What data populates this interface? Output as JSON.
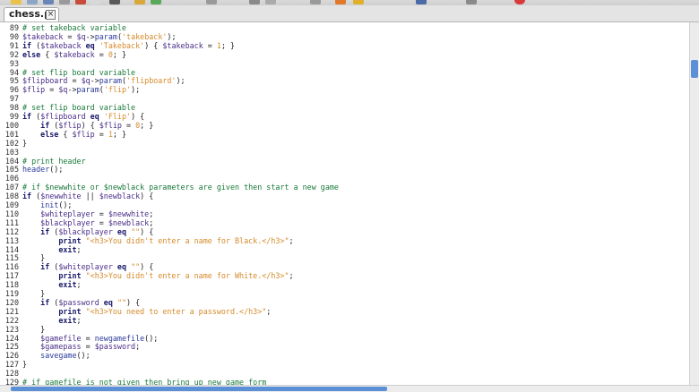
{
  "tab": {
    "title": "chess.pl",
    "close_glyph": "×"
  },
  "toolbar": {
    "icons": [
      "new-file-icon",
      "open-icon",
      "save-icon",
      "print-icon",
      "undo-icon",
      "redo-icon",
      "cut-icon",
      "copy-icon",
      "paste-icon",
      "find-icon",
      "replace-icon",
      "goto-icon",
      "bookmark-icon",
      "run-icon",
      "stop-icon",
      "bracket-icon",
      "settings-icon",
      "close-icon"
    ]
  },
  "lines": [
    {
      "n": "89",
      "html": "<span class='cm'># set takeback variable</span>"
    },
    {
      "n": "90",
      "html": "<span class='var'>$takeback</span> = <span class='var'>$q</span>-><span class='fn'>param</span>(<span class='str'>'takeback'</span>);"
    },
    {
      "n": "91",
      "html": "<span class='kw'>if</span> (<span class='var'>$takeback</span> <span class='kw'>eq</span> <span class='str'>'Takeback'</span>) { <span class='var'>$takeback</span> = <span class='str'>1</span>; }"
    },
    {
      "n": "92",
      "html": "<span class='kw'>else</span> { <span class='var'>$takeback</span> = <span class='str'>0</span>; }"
    },
    {
      "n": "93",
      "html": ""
    },
    {
      "n": "94",
      "html": "<span class='cm'># set flip board variable</span>"
    },
    {
      "n": "95",
      "html": "<span class='var'>$flipboard</span> = <span class='var'>$q</span>-><span class='fn'>param</span>(<span class='str'>'flipboard'</span>);"
    },
    {
      "n": "96",
      "html": "<span class='var'>$flip</span> = <span class='var'>$q</span>-><span class='fn'>param</span>(<span class='str'>'flip'</span>);"
    },
    {
      "n": "97",
      "html": ""
    },
    {
      "n": "98",
      "html": "<span class='cm'># set flip board variable</span>"
    },
    {
      "n": "99",
      "html": "<span class='kw'>if</span> (<span class='var'>$flipboard</span> <span class='kw'>eq</span> <span class='str'>'Flip'</span>) {"
    },
    {
      "n": "100",
      "html": "    <span class='kw'>if</span> (<span class='var'>$flip</span>) { <span class='var'>$flip</span> = <span class='str'>0</span>; }"
    },
    {
      "n": "101",
      "html": "    <span class='kw'>else</span> { <span class='var'>$flip</span> = <span class='str'>1</span>; }"
    },
    {
      "n": "102",
      "html": "}"
    },
    {
      "n": "103",
      "html": ""
    },
    {
      "n": "104",
      "html": "<span class='cm'># print header</span>"
    },
    {
      "n": "105",
      "html": "<span class='fn'>header</span>();"
    },
    {
      "n": "106",
      "html": ""
    },
    {
      "n": "107",
      "html": "<span class='cm'># if $newwhite or $newblack parameters are given then start a new game</span>"
    },
    {
      "n": "108",
      "html": "<span class='kw'>if</span> (<span class='var'>$newwhite</span> || <span class='var'>$newblack</span>) {"
    },
    {
      "n": "109",
      "html": "    <span class='fn'>init</span>();"
    },
    {
      "n": "110",
      "html": "    <span class='var'>$whiteplayer</span> = <span class='var'>$newwhite</span>;"
    },
    {
      "n": "111",
      "html": "    <span class='var'>$blackplayer</span> = <span class='var'>$newblack</span>;"
    },
    {
      "n": "112",
      "html": "    <span class='kw'>if</span> (<span class='var'>$blackplayer</span> <span class='kw'>eq</span> <span class='str'>\"\"</span>) {"
    },
    {
      "n": "113",
      "html": "        <span class='kw'>print</span> <span class='str'>\"&lt;h3&gt;You didn't enter a name for Black.&lt;/h3&gt;\"</span>;"
    },
    {
      "n": "114",
      "html": "        <span class='kw'>exit</span>;"
    },
    {
      "n": "115",
      "html": "    }"
    },
    {
      "n": "116",
      "html": "    <span class='kw'>if</span> (<span class='var'>$whiteplayer</span> <span class='kw'>eq</span> <span class='str'>\"\"</span>) {"
    },
    {
      "n": "117",
      "html": "        <span class='kw'>print</span> <span class='str'>\"&lt;h3&gt;You didn't enter a name for White.&lt;/h3&gt;\"</span>;"
    },
    {
      "n": "118",
      "html": "        <span class='kw'>exit</span>;"
    },
    {
      "n": "119",
      "html": "    }"
    },
    {
      "n": "120",
      "html": "    <span class='kw'>if</span> (<span class='var'>$password</span> <span class='kw'>eq</span> <span class='str'>\"\"</span>) {"
    },
    {
      "n": "121",
      "html": "        <span class='kw'>print</span> <span class='str'>\"&lt;h3&gt;You need to enter a password.&lt;/h3&gt;\"</span>;"
    },
    {
      "n": "122",
      "html": "        <span class='kw'>exit</span>;"
    },
    {
      "n": "123",
      "html": "    }"
    },
    {
      "n": "124",
      "html": "    <span class='var'>$gamefile</span> = <span class='fn'>newgamefile</span>();"
    },
    {
      "n": "125",
      "html": "    <span class='var'>$gamepass</span> = <span class='var'>$password</span>;"
    },
    {
      "n": "126",
      "html": "    <span class='fn'>savegame</span>();"
    },
    {
      "n": "127",
      "html": "}"
    },
    {
      "n": "128",
      "html": ""
    },
    {
      "n": "129",
      "html": "<span class='cm'># if gamefile is not given then bring up new game form</span>"
    }
  ],
  "colors": {
    "comment": "#1a7a3a",
    "keyword": "#1a1a6a",
    "variable": "#4a2e88",
    "string": "#d68a2a",
    "scroll_thumb": "#5b8fd6"
  }
}
